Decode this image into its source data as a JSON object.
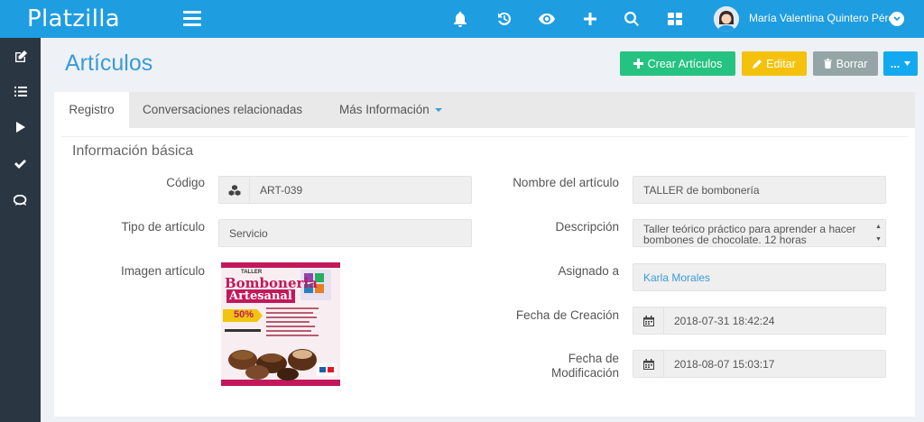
{
  "app": {
    "brand": "Platzilla",
    "user_name": "María Valentina Quintero Pérez"
  },
  "topbar": {
    "icons": [
      "bell-icon",
      "history-icon",
      "eye-icon",
      "plus-icon",
      "search-icon",
      "grid-icon"
    ]
  },
  "sidebar": {
    "items": [
      "edit-icon",
      "list-icon",
      "play-icon",
      "check-icon",
      "chat-icon"
    ]
  },
  "page": {
    "title": "Artículos"
  },
  "actions": {
    "create_label": "Crear Artículos",
    "edit_label": "Editar",
    "delete_label": "Borrar",
    "more_label": "..."
  },
  "tabs": [
    {
      "label": "Registro",
      "active": true
    },
    {
      "label": "Conversaciones relacionadas",
      "active": false
    },
    {
      "label": "Más Información",
      "active": false
    }
  ],
  "form": {
    "section_title": "Información básica",
    "codigo": {
      "label": "Código",
      "value": "ART-039"
    },
    "tipo": {
      "label": "Tipo de artículo",
      "value": "Servicio"
    },
    "imagen": {
      "label": "Imagen artículo"
    },
    "nombre": {
      "label": "Nombre del artículo",
      "value": "TALLER de bombonería"
    },
    "descripcion": {
      "label": "Descripción",
      "value": "Taller teórico práctico para aprender a hacer bombones de chocolate. 12 horas"
    },
    "asignado": {
      "label": "Asignado a",
      "value": "Karla Morales"
    },
    "fecha_creacion": {
      "label": "Fecha de Creación",
      "value": "2018-07-31 18:42:24"
    },
    "fecha_mod": {
      "label_line1": "Fecha de",
      "label_line2": "Modificación",
      "value": "2018-08-07 15:03:17"
    }
  },
  "poster": {
    "kicker": "TALLER",
    "title_line1": "Bomboneria",
    "title_line2": "Artesanal",
    "discount": "50%"
  },
  "colors": {
    "topbar": "#1f9de1",
    "sidebar": "#2b3643",
    "title": "#3a9bd8",
    "create": "#26c281",
    "edit": "#f4c20d",
    "delete": "#95a5a6",
    "more": "#13a9f0"
  }
}
